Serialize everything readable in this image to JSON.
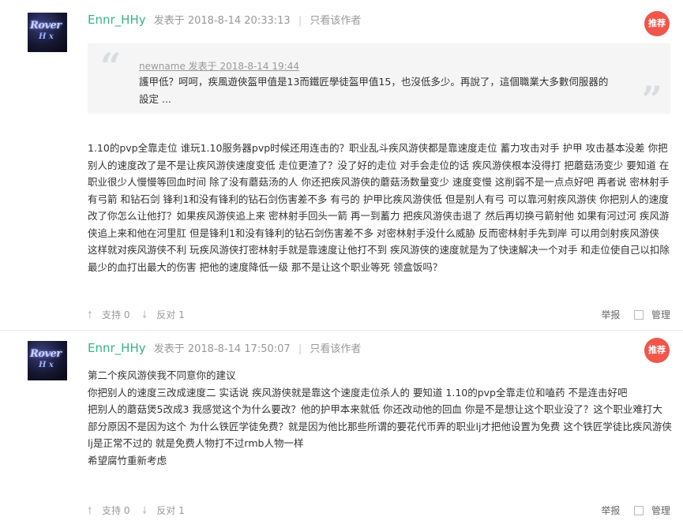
{
  "posts": [
    {
      "author": "Ennr_HHy",
      "posted_at": "发表于 2018-8-14 20:33:13",
      "only_author": "只看该作者",
      "badge": "推荐",
      "quote": {
        "head": "newname 发表于 2018-8-14 19:44",
        "body": "護甲低？呵呵，疾風遊俠盔甲值是13而鐵匠學徒盔甲值15，也沒低多少。再說了，這個職業大多數伺服器的設定 ..."
      },
      "content": "1.10的pvp全靠走位 谁玩1.10服务器pvp时候还用连击的？职业乱斗疾风游侠都是靠速度走位 蓄力攻击对手 护甲 攻击基本没差 你把别人的速度改了是不是让疾风游侠速度变低 走位更渣了？没了好的走位 对手会走位的话 疾风游侠根本没得打 把蘑菇汤变少 要知道 在职业很少人慢慢等回血时间 除了没有蘑菇汤的人 你还把疾风游侠的蘑菇汤数量变少 速度变慢 这削弱不是一点点好吧 再者说 密林射手有弓箭 和钻石剑 锋利1和没有锋利的钻石剑伤害差不多 有弓的 护甲比疾风游侠低 但是别人有弓 可以靠河射疾风游侠 你把别人的速度改了你怎么让他打？如果疾风游侠追上来 密林射手回头一箭 再一到蓄力 把疾风游侠击退了 然后再切换弓箭射他 如果有河过河 疾风游侠追上来和他在河里肛 但是锋利1和没有锋利的钻石剑伤害差不多 对密林射手没什么威胁 反而密林射手先到岸 可以用剑射疾风游侠 这样就对疾风游侠不利 玩疾风游侠打密林射手就是靠速度让他打不到 疾风游侠的速度就是为了快速解决一个对手 和走位使自己以扣除最少的血打出最大的伤害 把他的速度降低一级 那不是让这个职业等死 领盒饭吗？",
      "support": "支持 0",
      "oppose": "反对 1",
      "report": "举报",
      "manage": "管理"
    },
    {
      "author": "Ennr_HHy",
      "posted_at": "发表于 2018-8-14 17:50:07",
      "only_author": "只看该作者",
      "badge": "推荐",
      "content_lines": [
        "第二个疾风游侠我不同意你的建议",
        "你把别人的速度三改成速度二 实话说 疾风游侠就是靠这个速度走位杀人的 要知道 1.10的pvp全靠走位和嗑药 不是连击好吧",
        "把别人的蘑菇煲5改成3 我感觉这个为什么要改？他的护甲本来就低 你还改动他的回血 你是不是想让这个职业没了？这个职业难打大部分原因不是因为这个 为什么铁匠学徒免费？就是因为他比那些所谓的要花代币弄的职业lj才把他设置为免费 这个铁匠学徒比疾风游侠lj是正常不过的 就是免费人物打不过rmb人物一样",
        "希望腐竹重新考虑"
      ],
      "support": "支持 0",
      "oppose": "反对 1",
      "report": "举报",
      "manage": "管理"
    }
  ],
  "icons": {
    "up": "arrow-up-icon",
    "down": "arrow-down-icon",
    "quote_open": "quote-open-icon",
    "quote_close": "quote-close-icon"
  },
  "colors": {
    "author": "#36b37e",
    "badge": "#f0564a",
    "quote_bg": "#f5f5f5"
  }
}
